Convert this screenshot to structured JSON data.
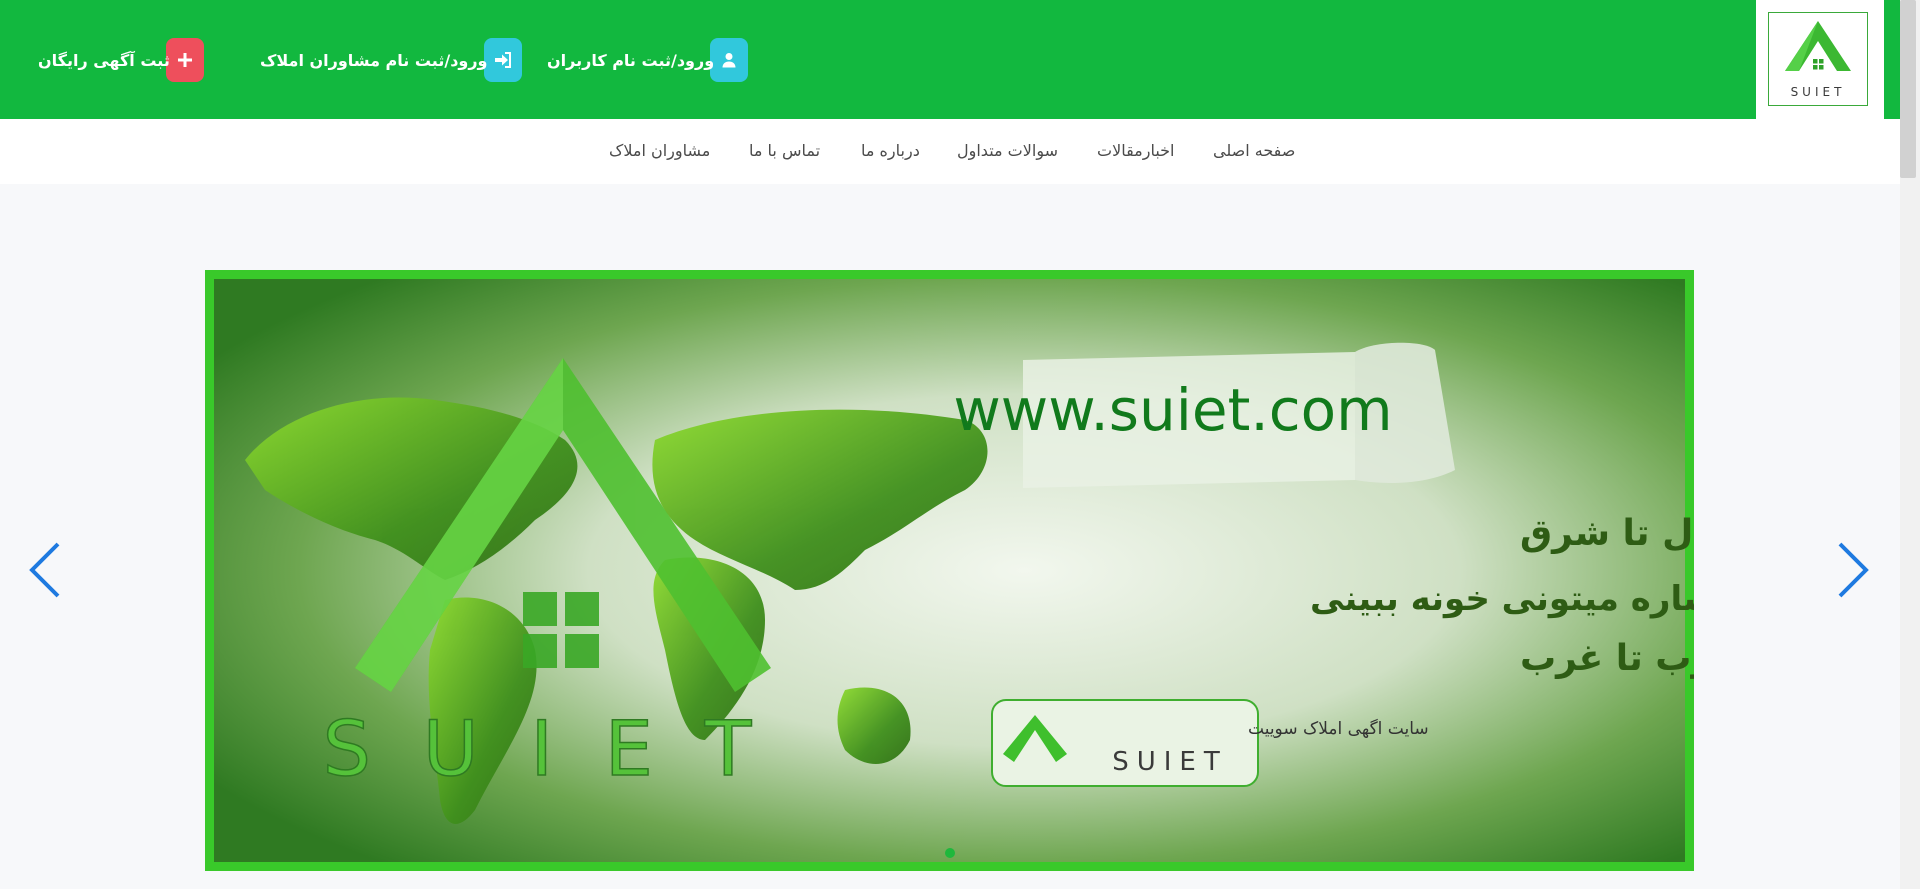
{
  "header": {
    "logo_text": "SUIET",
    "buttons": [
      {
        "label": "ورود/ثبت نام کاربران",
        "icon": "user-icon"
      },
      {
        "label": "ورود/ثبت نام مشاوران املاک",
        "icon": "sign-in-icon"
      },
      {
        "label": "ثبت آگهی رایگان",
        "icon": "plus-icon"
      }
    ]
  },
  "nav": {
    "items": [
      "صفحه اصلی",
      "اخبارمقالات",
      "سوالات متداول",
      "درباره ما",
      "تماس با ما",
      "مشاوران املاک"
    ]
  },
  "banner": {
    "url": "www.suiet.com",
    "line1": "از شمال تا شرق",
    "line2": "با یک اشاره میتونی خونه ببینی",
    "line3": "از جنوب تا غرب",
    "badge_caption": "سایت اگهی املاک سوییت",
    "badge_brand": "SUIET",
    "big_brand": "SUIET"
  },
  "colors": {
    "header_green": "#12b83f",
    "icon_cyan": "#31c8dc",
    "icon_red": "#ee4f5c",
    "arrow_blue": "#1e7ae0"
  }
}
